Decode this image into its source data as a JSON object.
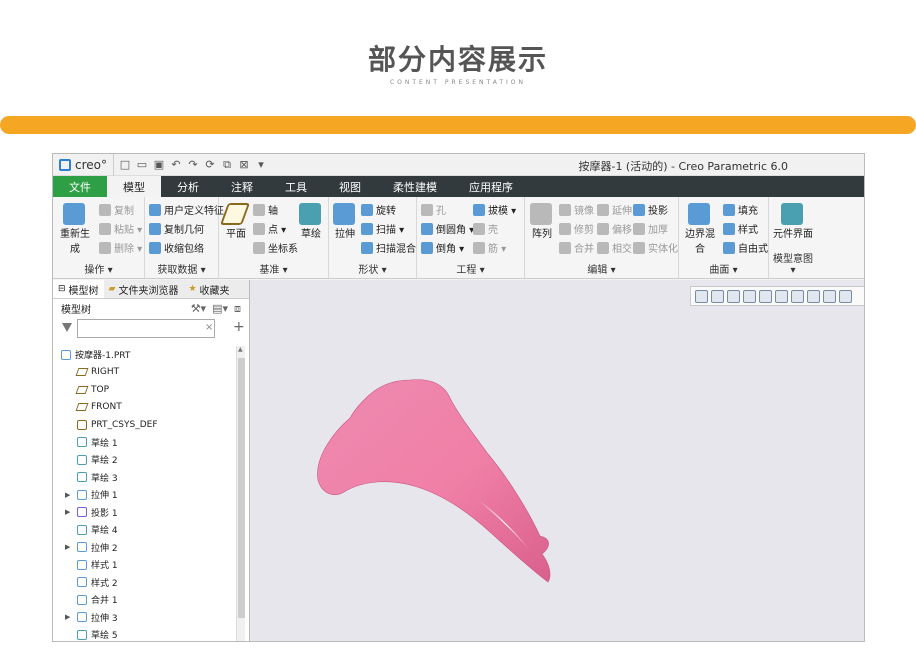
{
  "header": {
    "title": "部分内容展示",
    "subtitle": "CONTENT PRESENTATION"
  },
  "app": {
    "logo": "creo°",
    "window_title": "按摩器-1 (活动的) - Creo Parametric 6.0",
    "tabs": [
      "文件",
      "模型",
      "分析",
      "注释",
      "工具",
      "视图",
      "柔性建模",
      "应用程序"
    ],
    "groups": {
      "operations": {
        "label": "操作 ▾",
        "regenerate": "重新生成",
        "copy": "复制",
        "paste": "粘贴 ▾",
        "delete": "删除 ▾"
      },
      "get_data": {
        "label": "获取数据 ▾",
        "udf": "用户定义特征",
        "copy_geom": "复制几何",
        "shrinkwrap": "收缩包络"
      },
      "datum": {
        "label": "基准 ▾",
        "plane": "平面",
        "axis": "轴",
        "point": "点 ▾",
        "csys": "坐标系",
        "sketch": "草绘"
      },
      "shapes": {
        "label": "形状 ▾",
        "extrude": "拉伸",
        "revolve": "旋转",
        "sweep": "扫描 ▾",
        "swept_blend": "扫描混合"
      },
      "engineering": {
        "label": "工程 ▾",
        "hole": "孔",
        "round": "倒圆角 ▾",
        "chamfer": "倒角 ▾",
        "draft": "拔模 ▾",
        "shell": "壳",
        "rib": "筋 ▾"
      },
      "editing": {
        "label": "编辑 ▾",
        "pattern": "阵列",
        "mirror": "镜像",
        "trim": "修剪",
        "merge": "合并",
        "extend": "延伸",
        "offset": "偏移",
        "intersect": "相交",
        "project": "投影",
        "thicken": "加厚",
        "solidify": "实体化"
      },
      "surfaces": {
        "label": "曲面 ▾",
        "boundary_blend": "边界混合",
        "fill": "填充",
        "style": "样式",
        "freestyle": "自由式"
      },
      "model_intent": {
        "label": "模型意图 ▾",
        "component_interface": "元件界面"
      }
    },
    "panel": {
      "tabs": [
        "模型树",
        "文件夹浏览器",
        "收藏夹"
      ],
      "tree_title": "模型树",
      "tree": [
        {
          "label": "按摩器-1.PRT",
          "icon": "part-icon",
          "expand": ""
        },
        {
          "label": "RIGHT",
          "icon": "datum-plane-icon",
          "expand": ""
        },
        {
          "label": "TOP",
          "icon": "datum-plane-icon",
          "expand": ""
        },
        {
          "label": "FRONT",
          "icon": "datum-plane-icon",
          "expand": ""
        },
        {
          "label": "PRT_CSYS_DEF",
          "icon": "csys-icon",
          "expand": ""
        },
        {
          "label": "草绘 1",
          "icon": "sketch-icon",
          "expand": ""
        },
        {
          "label": "草绘 2",
          "icon": "sketch-icon",
          "expand": ""
        },
        {
          "label": "草绘 3",
          "icon": "sketch-icon",
          "expand": ""
        },
        {
          "label": "拉伸 1",
          "icon": "extrude-icon",
          "expand": "▶"
        },
        {
          "label": "投影 1",
          "icon": "project-icon",
          "expand": "▶"
        },
        {
          "label": "草绘 4",
          "icon": "sketch-icon",
          "expand": ""
        },
        {
          "label": "拉伸 2",
          "icon": "extrude-icon",
          "expand": "▶"
        },
        {
          "label": "样式 1",
          "icon": "style-icon",
          "expand": ""
        },
        {
          "label": "样式 2",
          "icon": "style-icon",
          "expand": ""
        },
        {
          "label": "合并 1",
          "icon": "merge-icon",
          "expand": ""
        },
        {
          "label": "拉伸 3",
          "icon": "extrude-icon",
          "expand": "▶"
        },
        {
          "label": "草绘 5",
          "icon": "sketch-icon",
          "expand": ""
        }
      ]
    },
    "colors": {
      "accent_bar": "#f5a623",
      "file_tab": "#2e9f45",
      "tab_bar": "#323a3d",
      "model": "#f07fa6"
    }
  }
}
